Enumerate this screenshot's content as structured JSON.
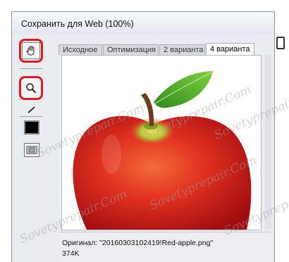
{
  "window": {
    "title": "Сохранить для Web (100%)"
  },
  "toolbar": {
    "tools": [
      {
        "name": "hand-tool",
        "icon": "hand-icon",
        "highlighted": true
      },
      {
        "name": "zoom-tool",
        "icon": "magnifier-icon",
        "highlighted": true
      },
      {
        "name": "eyedropper-tool",
        "icon": "eyedropper-icon"
      },
      {
        "name": "eyedropper-color",
        "icon": "color-swatch",
        "color": "#000000"
      },
      {
        "name": "toggle-slices",
        "icon": "preview-icon"
      }
    ],
    "highlight_color": "#d61f1f"
  },
  "tabs": [
    {
      "label": "Исходное"
    },
    {
      "label": "Оптимизация"
    },
    {
      "label": "2 варианта"
    },
    {
      "label": "4 варианта",
      "active": true
    }
  ],
  "preview": {
    "subject": "red-apple-image"
  },
  "status": {
    "original": "Оригинал: \"20160303102419!Red-apple.png\"",
    "size": "374K"
  },
  "watermark": "Sovetyprepair.Com"
}
